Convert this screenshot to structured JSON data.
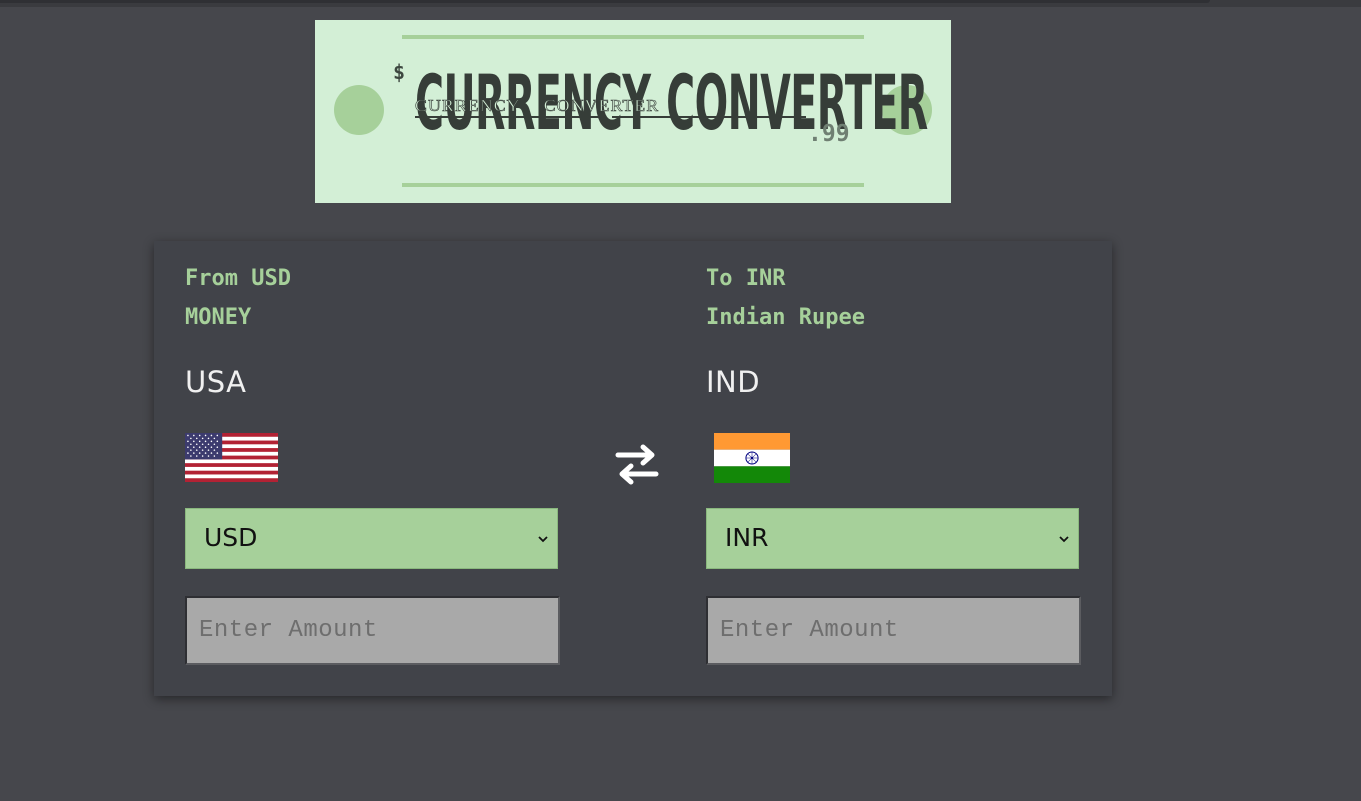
{
  "banner": {
    "dollar": "$",
    "title_word1": "CURRENCY",
    "title_word2": "CONVERTER",
    "cents": ".99"
  },
  "from": {
    "label": "From USD",
    "currency_name": "MONEY",
    "country": "USA",
    "flag_icon": "us-flag-icon",
    "selected_currency": "USD",
    "amount_placeholder": "Enter Amount"
  },
  "to": {
    "label": "To INR",
    "currency_name": "Indian Rupee",
    "country": "IND",
    "flag_icon": "india-flag-icon",
    "selected_currency": "INR",
    "amount_placeholder": "Enter Amount"
  },
  "swap_icon": "swap-arrows-icon",
  "colors": {
    "background": "#46474c",
    "card": "#414349",
    "accent_green": "#a6d09a",
    "banner_bg": "#d3efd6"
  }
}
